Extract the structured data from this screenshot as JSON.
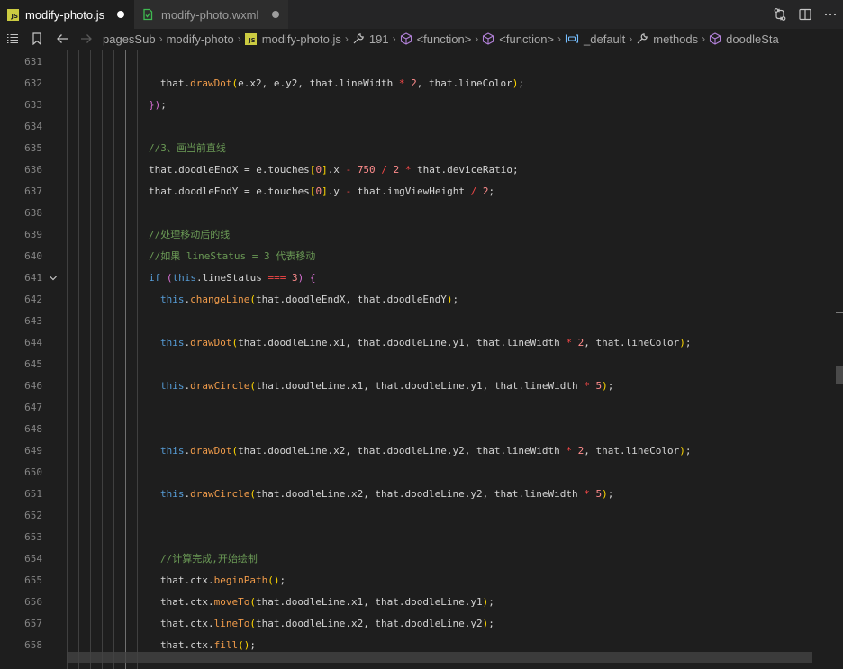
{
  "tabs": [
    {
      "label": "modify-photo.js",
      "icon": "js-file-icon",
      "badge": "JS",
      "dirty": true,
      "active": true
    },
    {
      "label": "modify-photo.wxml",
      "icon": "wxml-file-icon",
      "dirty": true,
      "active": false
    }
  ],
  "tab_actions": [
    "compare-changes-icon",
    "split-editor-icon",
    "more-actions-icon"
  ],
  "breadcrumb": {
    "folder": "pagesSub",
    "subfolder": "modify-photo",
    "file": "modify-photo.js",
    "file_badge": "JS",
    "line": "191",
    "fn1": "<function>",
    "fn2": "<function>",
    "default": "_default",
    "methods": "methods",
    "method": "doodleSta"
  },
  "colors": {
    "background": "#1e1e1e",
    "tabbar": "#252526",
    "function": "#f09b4a",
    "property": "#9cdcfe",
    "keyword": "#569cd6",
    "comment": "#6a9955",
    "number": "#ff8c8c"
  },
  "lines": [
    {
      "num": "631",
      "indent": 0,
      "tokens": []
    },
    {
      "num": "632",
      "indent": 178,
      "tokens": [
        {
          "t": "that.",
          "c": "d"
        },
        {
          "t": "drawDot",
          "c": "f"
        },
        {
          "t": "(",
          "c": "b2"
        },
        {
          "t": "e.x2, e.y2, that.lineWidth ",
          "c": "d"
        },
        {
          "t": "*",
          "c": "o"
        },
        {
          "t": " ",
          "c": "d"
        },
        {
          "t": "2",
          "c": "n"
        },
        {
          "t": ", that.lineColor",
          "c": "d"
        },
        {
          "t": ")",
          "c": "b2"
        },
        {
          "t": ";",
          "c": "d"
        }
      ]
    },
    {
      "num": "633",
      "indent": 165,
      "tokens": [
        {
          "t": "}",
          "c": "b1"
        },
        {
          "t": ")",
          "c": "b1"
        },
        {
          "t": ";",
          "c": "d"
        }
      ]
    },
    {
      "num": "634",
      "indent": 0,
      "tokens": []
    },
    {
      "num": "635",
      "indent": 165,
      "tokens": [
        {
          "t": "//3、画当前直线",
          "c": "c"
        }
      ]
    },
    {
      "num": "636",
      "indent": 165,
      "tokens": [
        {
          "t": "that.doodleEndX = e.touches",
          "c": "d"
        },
        {
          "t": "[",
          "c": "b2"
        },
        {
          "t": "0",
          "c": "n"
        },
        {
          "t": "]",
          "c": "b2"
        },
        {
          "t": ".x ",
          "c": "d"
        },
        {
          "t": "-",
          "c": "o"
        },
        {
          "t": " ",
          "c": "d"
        },
        {
          "t": "750",
          "c": "n"
        },
        {
          "t": " ",
          "c": "d"
        },
        {
          "t": "/",
          "c": "o"
        },
        {
          "t": " ",
          "c": "d"
        },
        {
          "t": "2",
          "c": "n"
        },
        {
          "t": " ",
          "c": "d"
        },
        {
          "t": "*",
          "c": "o"
        },
        {
          "t": " that.deviceRatio;",
          "c": "d"
        }
      ]
    },
    {
      "num": "637",
      "indent": 165,
      "tokens": [
        {
          "t": "that.doodleEndY = e.touches",
          "c": "d"
        },
        {
          "t": "[",
          "c": "b2"
        },
        {
          "t": "0",
          "c": "n"
        },
        {
          "t": "]",
          "c": "b2"
        },
        {
          "t": ".y ",
          "c": "d"
        },
        {
          "t": "-",
          "c": "o"
        },
        {
          "t": " that.imgViewHeight ",
          "c": "d"
        },
        {
          "t": "/",
          "c": "o"
        },
        {
          "t": " ",
          "c": "d"
        },
        {
          "t": "2",
          "c": "n"
        },
        {
          "t": ";",
          "c": "d"
        }
      ]
    },
    {
      "num": "638",
      "indent": 0,
      "tokens": []
    },
    {
      "num": "639",
      "indent": 165,
      "tokens": [
        {
          "t": "//处理移动后的线",
          "c": "c"
        }
      ]
    },
    {
      "num": "640",
      "indent": 165,
      "tokens": [
        {
          "t": "//如果 lineStatus = 3 代表移动",
          "c": "c"
        }
      ]
    },
    {
      "num": "641",
      "indent": 165,
      "fold": true,
      "tokens": [
        {
          "t": "if",
          "c": "k"
        },
        {
          "t": " ",
          "c": "d"
        },
        {
          "t": "(",
          "c": "b1"
        },
        {
          "t": "this",
          "c": "k"
        },
        {
          "t": ".lineStatus ",
          "c": "d"
        },
        {
          "t": "===",
          "c": "o"
        },
        {
          "t": " ",
          "c": "d"
        },
        {
          "t": "3",
          "c": "n"
        },
        {
          "t": ")",
          "c": "b1"
        },
        {
          "t": " ",
          "c": "d"
        },
        {
          "t": "{",
          "c": "b1"
        }
      ]
    },
    {
      "num": "642",
      "indent": 178,
      "tokens": [
        {
          "t": "this",
          "c": "k"
        },
        {
          "t": ".",
          "c": "d"
        },
        {
          "t": "changeLine",
          "c": "f"
        },
        {
          "t": "(",
          "c": "b2"
        },
        {
          "t": "that.doodleEndX, that.doodleEndY",
          "c": "d"
        },
        {
          "t": ")",
          "c": "b2"
        },
        {
          "t": ";",
          "c": "d"
        }
      ]
    },
    {
      "num": "643",
      "indent": 0,
      "tokens": []
    },
    {
      "num": "644",
      "indent": 178,
      "tokens": [
        {
          "t": "this",
          "c": "k"
        },
        {
          "t": ".",
          "c": "d"
        },
        {
          "t": "drawDot",
          "c": "f"
        },
        {
          "t": "(",
          "c": "b2"
        },
        {
          "t": "that.doodleLine.x1, that.doodleLine.y1, that.lineWidth ",
          "c": "d"
        },
        {
          "t": "*",
          "c": "o"
        },
        {
          "t": " ",
          "c": "d"
        },
        {
          "t": "2",
          "c": "n"
        },
        {
          "t": ", that.lineColor",
          "c": "d"
        },
        {
          "t": ")",
          "c": "b2"
        },
        {
          "t": ";",
          "c": "d"
        }
      ]
    },
    {
      "num": "645",
      "indent": 0,
      "tokens": []
    },
    {
      "num": "646",
      "indent": 178,
      "tokens": [
        {
          "t": "this",
          "c": "k"
        },
        {
          "t": ".",
          "c": "d"
        },
        {
          "t": "drawCircle",
          "c": "f"
        },
        {
          "t": "(",
          "c": "b2"
        },
        {
          "t": "that.doodleLine.x1, that.doodleLine.y1, that.lineWidth ",
          "c": "d"
        },
        {
          "t": "*",
          "c": "o"
        },
        {
          "t": " ",
          "c": "d"
        },
        {
          "t": "5",
          "c": "n"
        },
        {
          "t": ")",
          "c": "b2"
        },
        {
          "t": ";",
          "c": "d"
        }
      ]
    },
    {
      "num": "647",
      "indent": 0,
      "tokens": []
    },
    {
      "num": "648",
      "indent": 0,
      "tokens": []
    },
    {
      "num": "649",
      "indent": 178,
      "tokens": [
        {
          "t": "this",
          "c": "k"
        },
        {
          "t": ".",
          "c": "d"
        },
        {
          "t": "drawDot",
          "c": "f"
        },
        {
          "t": "(",
          "c": "b2"
        },
        {
          "t": "that.doodleLine.x2, that.doodleLine.y2, that.lineWidth ",
          "c": "d"
        },
        {
          "t": "*",
          "c": "o"
        },
        {
          "t": " ",
          "c": "d"
        },
        {
          "t": "2",
          "c": "n"
        },
        {
          "t": ", that.lineColor",
          "c": "d"
        },
        {
          "t": ")",
          "c": "b2"
        },
        {
          "t": ";",
          "c": "d"
        }
      ]
    },
    {
      "num": "650",
      "indent": 0,
      "tokens": []
    },
    {
      "num": "651",
      "indent": 178,
      "tokens": [
        {
          "t": "this",
          "c": "k"
        },
        {
          "t": ".",
          "c": "d"
        },
        {
          "t": "drawCircle",
          "c": "f"
        },
        {
          "t": "(",
          "c": "b2"
        },
        {
          "t": "that.doodleLine.x2, that.doodleLine.y2, that.lineWidth ",
          "c": "d"
        },
        {
          "t": "*",
          "c": "o"
        },
        {
          "t": " ",
          "c": "d"
        },
        {
          "t": "5",
          "c": "n"
        },
        {
          "t": ")",
          "c": "b2"
        },
        {
          "t": ";",
          "c": "d"
        }
      ]
    },
    {
      "num": "652",
      "indent": 0,
      "tokens": []
    },
    {
      "num": "653",
      "indent": 0,
      "tokens": []
    },
    {
      "num": "654",
      "indent": 178,
      "tokens": [
        {
          "t": "//计算完成,开始绘制",
          "c": "c"
        }
      ]
    },
    {
      "num": "655",
      "indent": 178,
      "tokens": [
        {
          "t": "that.ctx.",
          "c": "d"
        },
        {
          "t": "beginPath",
          "c": "f"
        },
        {
          "t": "(",
          "c": "b2"
        },
        {
          "t": ")",
          "c": "b2"
        },
        {
          "t": ";",
          "c": "d"
        }
      ]
    },
    {
      "num": "656",
      "indent": 178,
      "tokens": [
        {
          "t": "that.ctx.",
          "c": "d"
        },
        {
          "t": "moveTo",
          "c": "f"
        },
        {
          "t": "(",
          "c": "b2"
        },
        {
          "t": "that.doodleLine.x1, that.doodleLine.y1",
          "c": "d"
        },
        {
          "t": ")",
          "c": "b2"
        },
        {
          "t": ";",
          "c": "d"
        }
      ]
    },
    {
      "num": "657",
      "indent": 178,
      "tokens": [
        {
          "t": "that.ctx.",
          "c": "d"
        },
        {
          "t": "lineTo",
          "c": "f"
        },
        {
          "t": "(",
          "c": "b2"
        },
        {
          "t": "that.doodleLine.x2, that.doodleLine.y2",
          "c": "d"
        },
        {
          "t": ")",
          "c": "b2"
        },
        {
          "t": ";",
          "c": "d"
        }
      ]
    },
    {
      "num": "658",
      "indent": 178,
      "tokens": [
        {
          "t": "that.ctx.",
          "c": "d"
        },
        {
          "t": "fill",
          "c": "f"
        },
        {
          "t": "(",
          "c": "b2"
        },
        {
          "t": ")",
          "c": "b2"
        },
        {
          "t": ";",
          "c": "d"
        }
      ]
    }
  ]
}
